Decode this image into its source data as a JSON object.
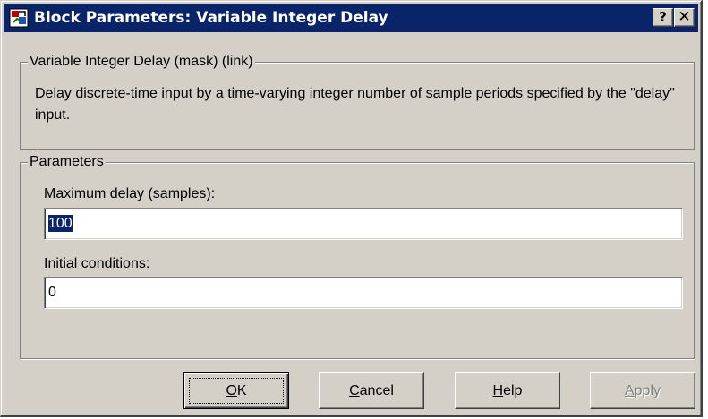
{
  "window": {
    "title": "Block Parameters: Variable Integer Delay",
    "help_glyph": "?",
    "close_glyph": "✕"
  },
  "description_group": {
    "legend": "Variable Integer Delay (mask) (link)",
    "text": "Delay discrete-time input by a time-varying integer number of sample periods specified by the \"delay\" input."
  },
  "parameters_group": {
    "legend": "Parameters",
    "fields": [
      {
        "label": "Maximum delay (samples):",
        "value": "100"
      },
      {
        "label": "Initial conditions:",
        "value": "0"
      }
    ]
  },
  "buttons": {
    "ok": {
      "mnemonic": "O",
      "rest": "K"
    },
    "cancel": {
      "mnemonic": "C",
      "rest": "ancel"
    },
    "help": {
      "mnemonic": "H",
      "rest": "elp"
    },
    "apply": {
      "mnemonic": "A",
      "rest": "pply",
      "enabled": false
    }
  },
  "colors": {
    "titlebar": "#0a246a",
    "face": "#d4d0c8",
    "selection": "#0a246a"
  }
}
